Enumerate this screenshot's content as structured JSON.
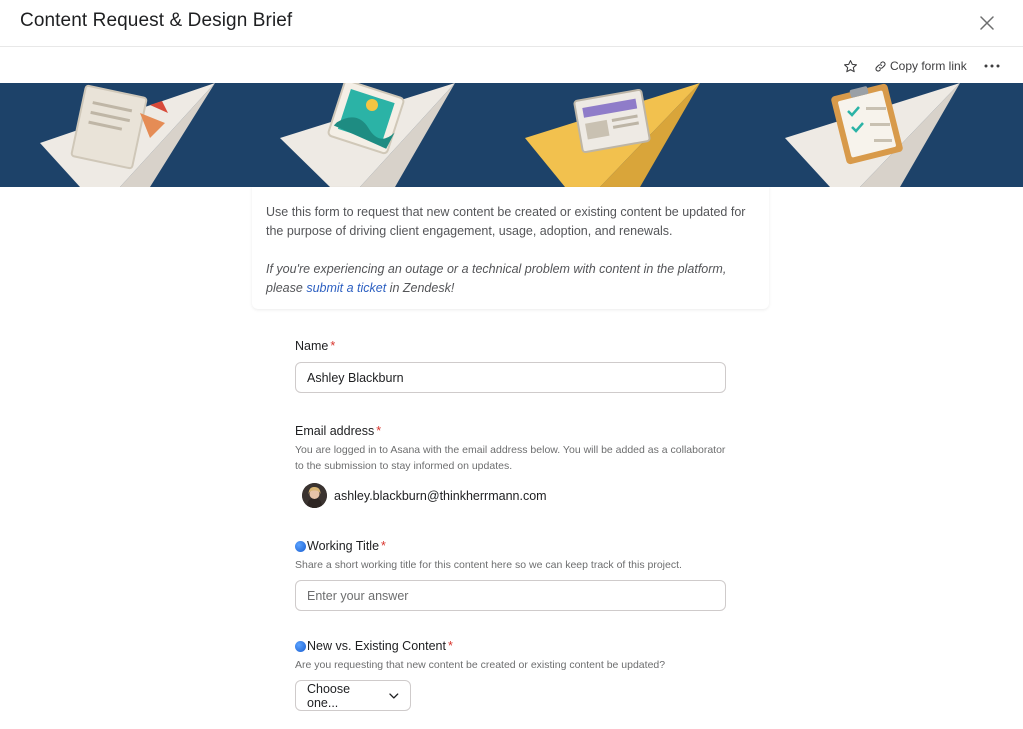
{
  "header": {
    "title": "Content Request & Design Brief"
  },
  "toolbar": {
    "copy_link_label": "Copy form link"
  },
  "intro": {
    "line1": "Use this form to request that new content be created or existing content be updated for the purpose of driving client engagement, usage, adoption, and renewals.",
    "italic_before": "If you're experiencing an outage or a technical problem with content in the platform, please ",
    "link_text": "submit a ticket",
    "italic_after": " in Zendesk!"
  },
  "fields": {
    "name": {
      "label": "Name",
      "required_mark": "*",
      "value": "Ashley Blackburn"
    },
    "email": {
      "label": "Email address",
      "required_mark": "*",
      "help": "You are logged in to Asana with the email address below. You will be added as a collaborator to the submission to stay informed on updates.",
      "value": "ashley.blackburn@thinkherrmann.com"
    },
    "working_title": {
      "label": "Working Title",
      "required_mark": "*",
      "help": "Share a short working title for this content here so we can keep track of this project.",
      "placeholder": "Enter your answer"
    },
    "new_vs_existing": {
      "label": "New vs. Existing Content",
      "required_mark": "*",
      "help": "Are you requesting that new content be created or existing content be updated?",
      "selected": "Choose one..."
    }
  },
  "colors": {
    "banner": "#1d4269",
    "accent_link": "#2c5fc1",
    "required": "#d8342c"
  },
  "icons": [
    "close-icon",
    "star-icon",
    "link-icon",
    "more-icon",
    "blue-circle-icon",
    "chevron-down-icon"
  ]
}
